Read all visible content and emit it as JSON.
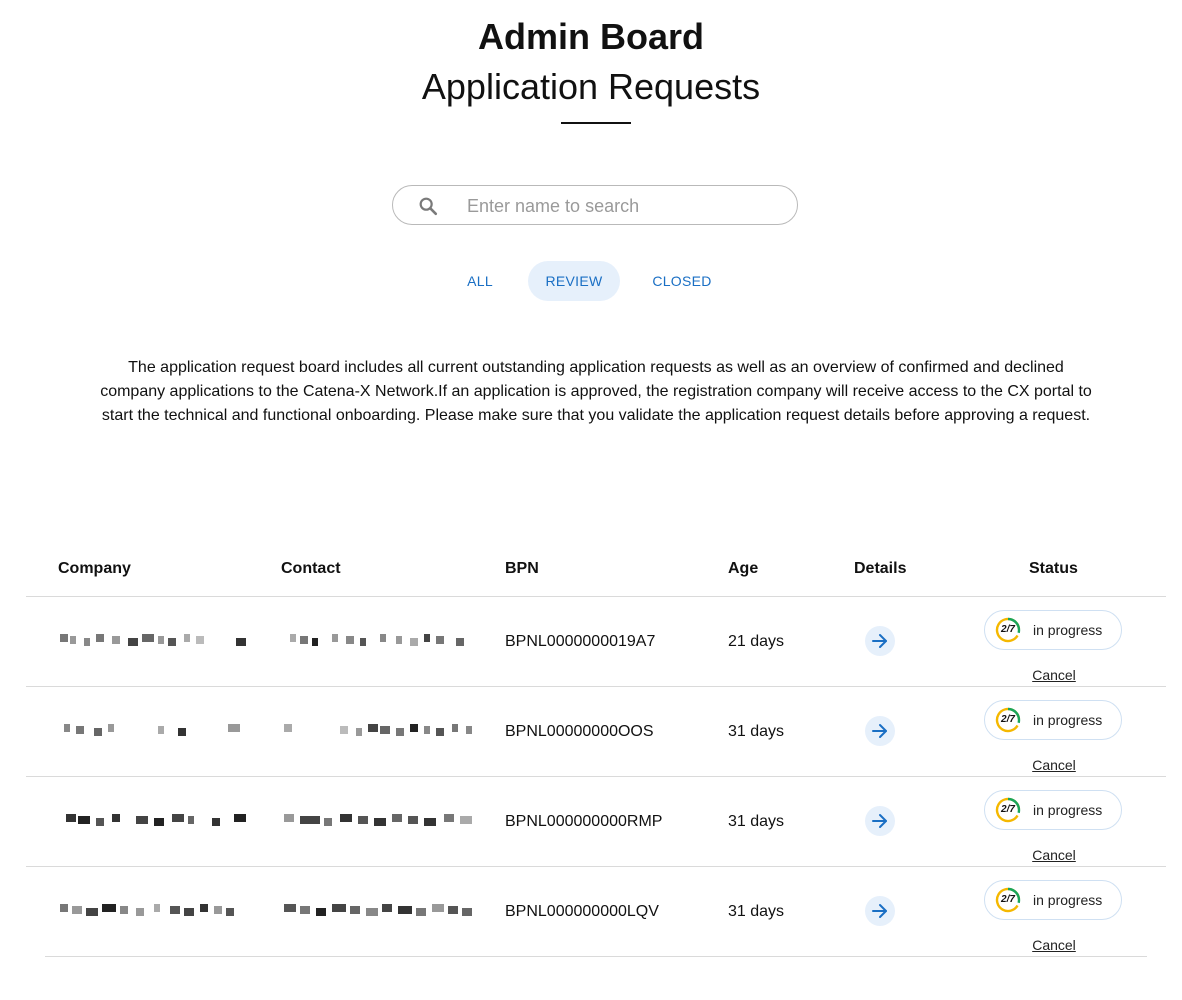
{
  "header": {
    "title": "Admin Board",
    "subtitle": "Application Requests"
  },
  "search": {
    "placeholder": "Enter name to search",
    "value": "",
    "icon": "search-icon"
  },
  "tabs": [
    {
      "label": "ALL",
      "active": false
    },
    {
      "label": "REVIEW",
      "active": true
    },
    {
      "label": "CLOSED",
      "active": false
    }
  ],
  "description": "The application request board includes all current outstanding application requests as well as an overview of confirmed and declined company applications to the Catena-X Network.If an application is approved, the registration company will receive access to the CX portal to start the technical and functional onboarding. Please make sure that you validate the application request details before approving a request.",
  "table": {
    "columns": [
      "Company",
      "Contact",
      "BPN",
      "Age",
      "Details",
      "Status"
    ],
    "rows": [
      {
        "company": "",
        "contact": "",
        "bpn": "BPNL0000000019A7",
        "age": "21 days",
        "details_icon": "arrow-right-icon",
        "progress": "2/7",
        "status": "in progress",
        "cancel": "Cancel"
      },
      {
        "company": "",
        "contact": "",
        "bpn": "BPNL00000000OOS",
        "age": "31 days",
        "details_icon": "arrow-right-icon",
        "progress": "2/7",
        "status": "in progress",
        "cancel": "Cancel"
      },
      {
        "company": "",
        "contact": "",
        "bpn": "BPNL000000000RMP",
        "age": "31 days",
        "details_icon": "arrow-right-icon",
        "progress": "2/7",
        "status": "in progress",
        "cancel": "Cancel"
      },
      {
        "company": "",
        "contact": "",
        "bpn": "BPNL000000000LQV",
        "age": "31 days",
        "details_icon": "arrow-right-icon",
        "progress": "2/7",
        "status": "in progress",
        "cancel": "Cancel"
      }
    ]
  },
  "colors": {
    "accent": "#1a6fc4",
    "accent_bg": "#e6f0fb",
    "progress_done": "#19a55a",
    "progress_pending": "#f5b800"
  }
}
